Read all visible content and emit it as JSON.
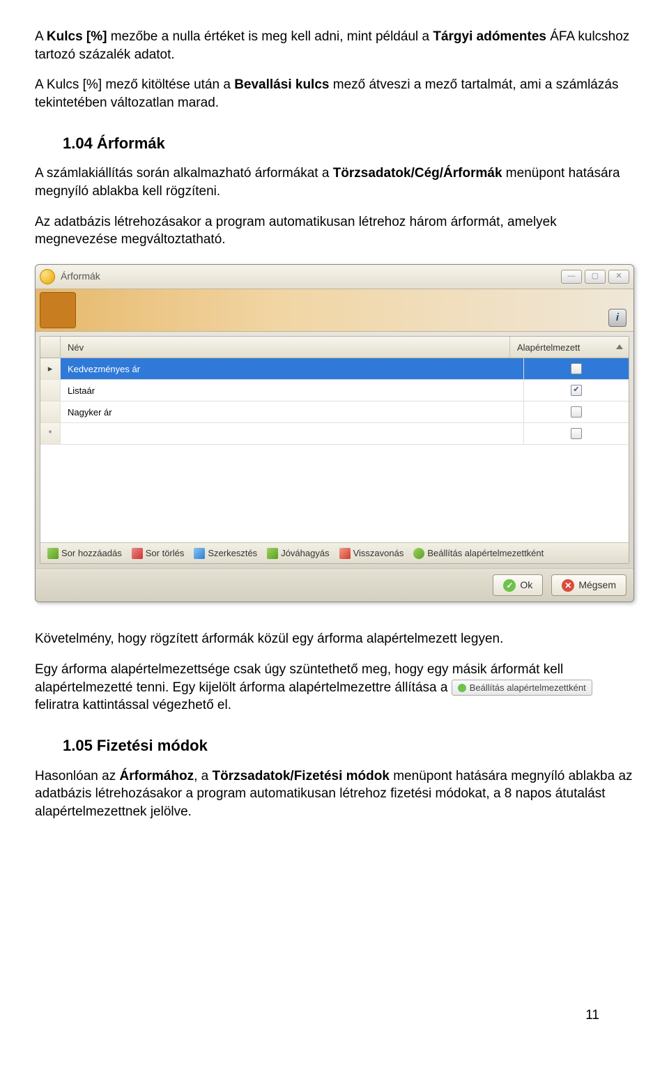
{
  "para1_a": "A ",
  "para1_b": "Kulcs [%]",
  "para1_c": " mezőbe a nulla értéket is meg kell adni, mint például a ",
  "para1_d": "Tárgyi adómentes",
  "para1_e": " ÁFA kulcshoz tartozó százalék adatot.",
  "para2_a": "A Kulcs [%] mező kitöltése után a ",
  "para2_b": "Bevallási kulcs",
  "para2_c": " mező átveszi a mező tartalmát, ami a számlázás tekintetében változatlan marad.",
  "h1": "1.04 Árformák",
  "para3_a": "A számlakiállítás során alkalmazható árformákat a ",
  "para3_b": "Törzsadatok/Cég/Árformák",
  "para3_c": " menüpont hatására megnyíló ablakba kell rögzíteni.",
  "para4": "Az adatbázis létrehozásakor a program automatikusan létrehoz három árformát, amelyek megnevezése megváltoztatható.",
  "window": {
    "title": "Árformák",
    "col_name": "Név",
    "col_default": "Alapértelmezett",
    "rows": [
      {
        "pointer": "▸",
        "name": "Kedvezményes ár",
        "checked": false,
        "selected": true
      },
      {
        "pointer": "",
        "name": "Listaár",
        "checked": true,
        "selected": false
      },
      {
        "pointer": "",
        "name": "Nagyker ár",
        "checked": false,
        "selected": false
      },
      {
        "pointer": "*",
        "name": "",
        "checked": false,
        "selected": false
      }
    ],
    "toolbar": {
      "add": "Sor hozzáadás",
      "del": "Sor törlés",
      "edit": "Szerkesztés",
      "approve": "Jóváhagyás",
      "undo": "Visszavonás",
      "setdefault": "Beállítás alapértelmezettként"
    },
    "ok": "Ok",
    "cancel": "Mégsem"
  },
  "para5": "Követelmény, hogy rögzített árformák közül egy árforma alapértelmezett legyen.",
  "para6_a": "Egy árforma alapértelmezettsége csak úgy szüntethető meg, hogy egy másik árformát kell alapértelmezetté tenni. Egy kijelölt árforma alapértelmezettre állítása a ",
  "inline_btn": "Beállítás alapértelmezettként",
  "para6_b": " feliratra kattintással végezhető el.",
  "h2": "1.05 Fizetési módok",
  "para7_a": "Hasonlóan az ",
  "para7_b": "Árformához",
  "para7_c": ", a ",
  "para7_d": "Törzsadatok/Fizetési módok",
  "para7_e": " menüpont hatására megnyíló ablakba az adatbázis létrehozásakor a program automatikusan létrehoz fizetési módokat, a 8 napos átutalást alapértelmezettnek jelölve.",
  "page": "11"
}
